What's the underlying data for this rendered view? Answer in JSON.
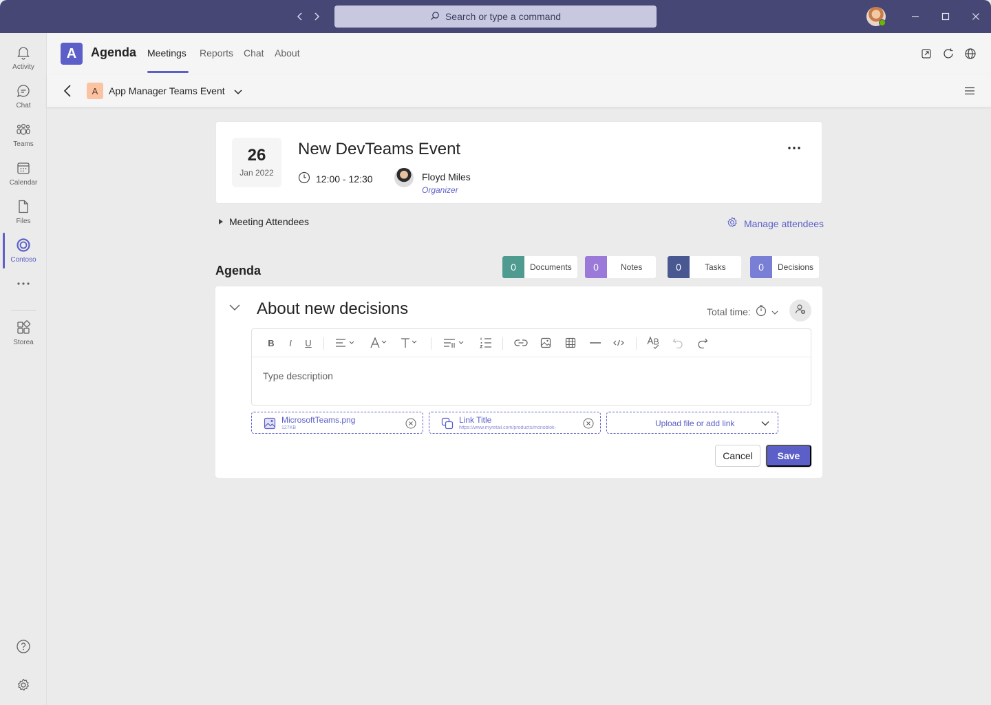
{
  "titlebar": {
    "search_placeholder": "Search or type a command"
  },
  "rail": {
    "items": [
      {
        "label": "Activity",
        "icon": "bell-icon"
      },
      {
        "label": "Chat",
        "icon": "chat-icon"
      },
      {
        "label": "Teams",
        "icon": "teams-icon"
      },
      {
        "label": "Calendar",
        "icon": "calendar-icon"
      },
      {
        "label": "Files",
        "icon": "file-icon"
      },
      {
        "label": "Contoso",
        "icon": "contoso-icon",
        "active": true
      },
      {
        "label": "Storea",
        "icon": "store-icon"
      }
    ]
  },
  "app": {
    "logo_letter": "A",
    "name": "Agenda",
    "tabs": [
      {
        "label": "Meetings",
        "active": true
      },
      {
        "label": "Reports"
      },
      {
        "label": "Chat"
      },
      {
        "label": "About"
      }
    ]
  },
  "breadcrumb": {
    "badge": "A",
    "title": "App Manager Teams Event"
  },
  "meeting": {
    "day": "26",
    "month_year": "Jan 2022",
    "title": "New DevTeams Event",
    "time": "12:00 - 12:30",
    "organizer_name": "Floyd Miles",
    "organizer_role": "Organizer"
  },
  "attendees": {
    "label": "Meeting Attendees",
    "manage_label": "Manage attendees"
  },
  "agenda": {
    "title": "Agenda",
    "counters": [
      {
        "count": "0",
        "label": "Documents",
        "color": "#4f9b8f"
      },
      {
        "count": "0",
        "label": "Notes",
        "color": "#9a79d8"
      },
      {
        "count": "0",
        "label": "Tasks",
        "color": "#4a5891"
      },
      {
        "count": "0",
        "label": "Decisions",
        "color": "#7a7fd6"
      }
    ]
  },
  "item": {
    "title": "About new decisions",
    "total_time_label": "Total time:",
    "description_placeholder": "Type description",
    "attachments": [
      {
        "title": "MicrosoftTeams.png",
        "subtitle": "127KB",
        "icon": "image-file-icon"
      },
      {
        "title": "Link Title",
        "subtitle": "https://www.myretail.com/products/monoblok-",
        "icon": "link-icon"
      }
    ],
    "upload_label": "Upload file or add link",
    "cancel_label": "Cancel",
    "save_label": "Save"
  },
  "colors": {
    "accent": "#5b5fc7",
    "titlebar": "#464775"
  }
}
